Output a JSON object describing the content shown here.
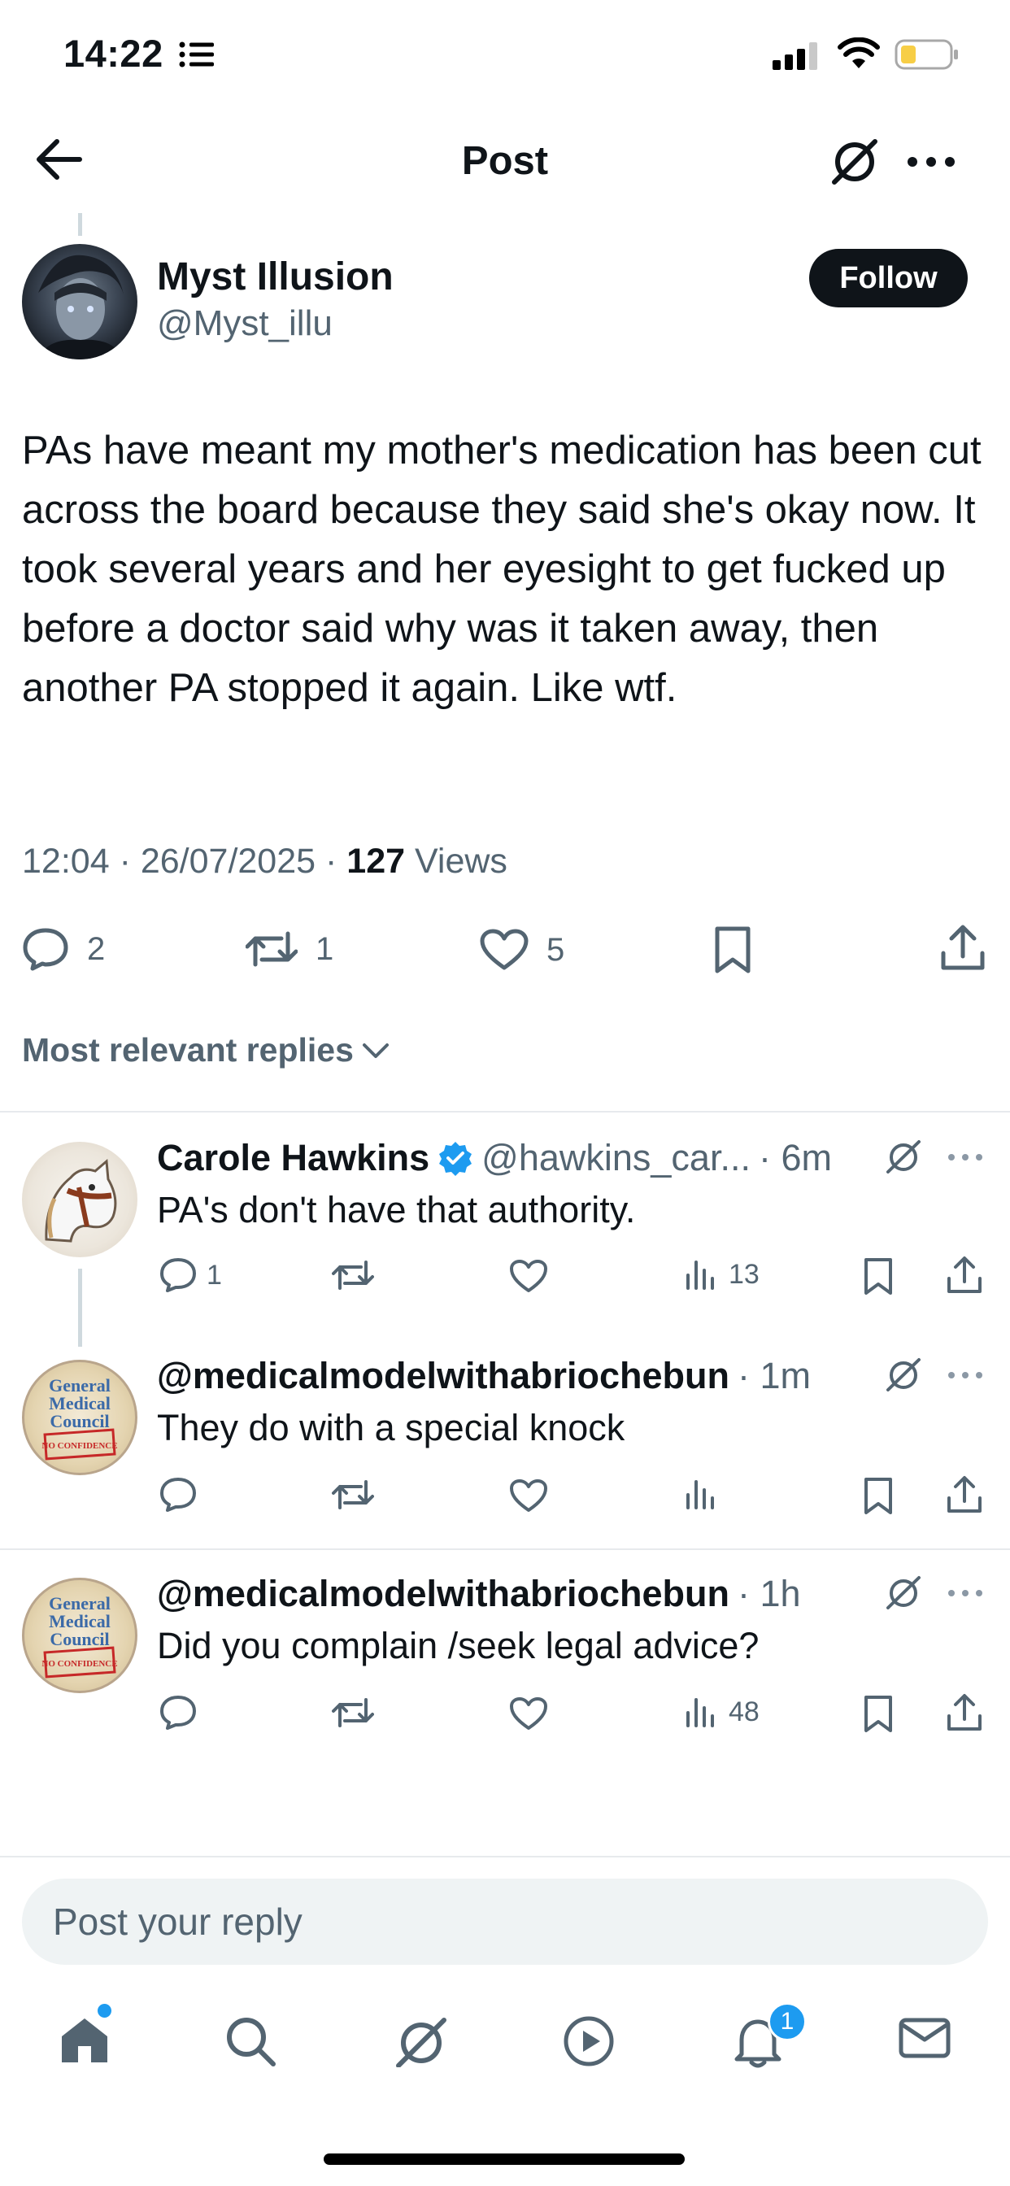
{
  "status_bar": {
    "time": "14:22"
  },
  "header": {
    "title": "Post"
  },
  "post": {
    "author_name": "Myst Illusion",
    "author_handle": "@Myst_illu",
    "follow_label": "Follow",
    "text": "PAs have meant my mother's medication has been cut across the board because they said she's okay now. It took several years and her eyesight to get fucked up before a doctor said why was it taken away, then another PA stopped it again. Like wtf.",
    "time": "12:04",
    "date": "26/07/2025",
    "views_count": "127",
    "views_label": "Views",
    "replies": "2",
    "reposts": "1",
    "likes": "5"
  },
  "sort": {
    "label": "Most relevant replies"
  },
  "replies": [
    {
      "name": "Carole Hawkins",
      "verified": true,
      "handle": "@hawkins_car...",
      "time": "· 6m",
      "text": "PA's don't have that authority.",
      "reply_count": "1",
      "views": "13"
    },
    {
      "name": "",
      "handle": "@medicalmodelwithabriochebun",
      "time": "· 1m",
      "text": "They do with a special knock",
      "reply_count": "",
      "views": ""
    },
    {
      "name": "",
      "handle": "@medicalmodelwithabriochebun",
      "time": "· 1h",
      "text": "Did you complain /seek legal advice?",
      "reply_count": "",
      "views": "48"
    }
  ],
  "avatar_text": {
    "gmc_line1": "General",
    "gmc_line2": "Medical",
    "gmc_line3": "Council",
    "gmc_stamp": "NO CONFIDENCE"
  },
  "compose": {
    "placeholder": "Post your reply"
  },
  "tab_bar": {
    "notifications_badge": "1"
  },
  "colors": {
    "text_primary": "#0f1419",
    "text_secondary": "#536471",
    "accent": "#1d9bf0",
    "divider": "#e7eaed"
  },
  "icons": [
    "back-arrow-icon",
    "grok-icon",
    "more-icon",
    "reply-icon",
    "repost-icon",
    "like-icon",
    "bookmark-icon",
    "share-icon",
    "views-icon",
    "chevron-down-icon",
    "verified-badge-icon",
    "home-icon",
    "search-icon",
    "play-icon",
    "bell-icon",
    "mail-icon"
  ]
}
